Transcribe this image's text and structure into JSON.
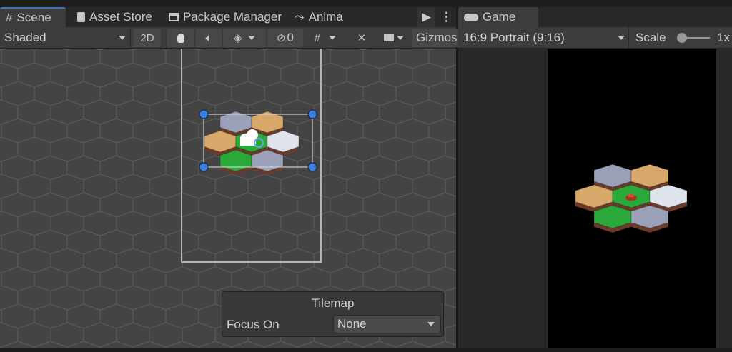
{
  "tabs": {
    "scene": "Scene",
    "asset_store": "Asset Store",
    "package_manager": "Package Manager",
    "animation": "Anima",
    "game": "Game"
  },
  "scene_toolbar": {
    "shading_mode": "Shaded",
    "mode_2d": "2D",
    "hidden_count": "0",
    "gizmos": "Gizmos"
  },
  "game_toolbar": {
    "aspect": "16:9 Portrait (9:16)",
    "scale_label": "Scale",
    "scale_value": "1x",
    "scale_fraction": 0
  },
  "tilemap_overlay": {
    "title": "Tilemap",
    "focus_label": "Focus On",
    "focus_value": "None"
  },
  "tile_colors": {
    "gray": "#9aa0b8",
    "tan": "#d8a86a",
    "green": "#2aa83a",
    "white": "#dfe3ec",
    "side": "#6b3a2a",
    "selection_handle": "#3a7ee0",
    "accent": "#3a79bb"
  }
}
